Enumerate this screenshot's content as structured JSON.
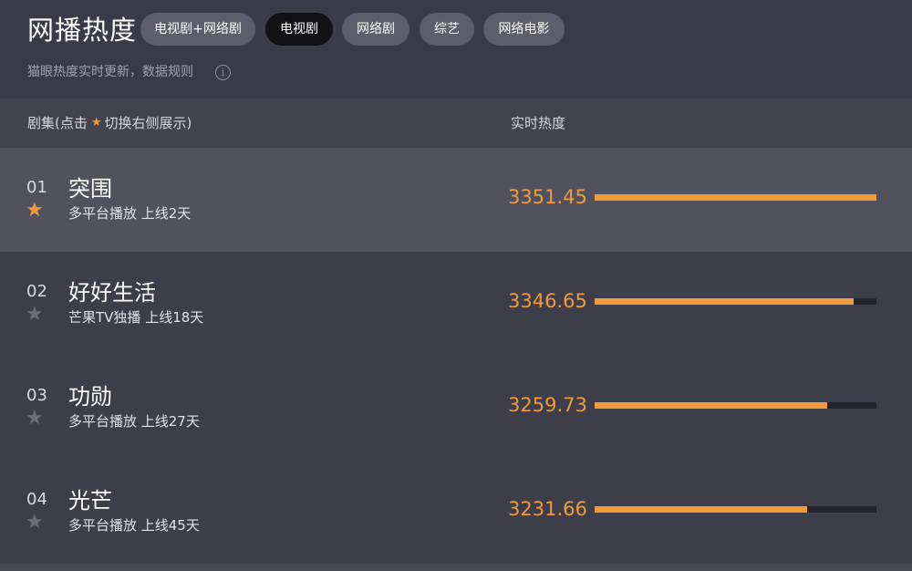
{
  "header": {
    "title": "网播热度",
    "tabs": [
      {
        "label": "电视剧+网络剧",
        "active": false
      },
      {
        "label": "电视剧",
        "active": true
      },
      {
        "label": "网络剧",
        "active": false
      },
      {
        "label": "综艺",
        "active": false
      },
      {
        "label": "网络电影",
        "active": false
      }
    ],
    "subtitle": "猫眼热度实时更新，数据规则",
    "info_icon": "info-icon"
  },
  "columns": {
    "left_prefix": "剧集(点击",
    "left_suffix": "切换右侧展示)",
    "right": "实时热度"
  },
  "rows": [
    {
      "rank": "01",
      "name": "突围",
      "meta": "多平台播放  上线2天",
      "score": "3351.45",
      "starred": true,
      "bar_fraction": 1.0
    },
    {
      "rank": "02",
      "name": "好好生活",
      "meta": "芒果TV独播  上线18天",
      "score": "3346.65",
      "starred": false,
      "bar_fraction": 0.92
    },
    {
      "rank": "03",
      "name": "功勋",
      "meta": "多平台播放  上线27天",
      "score": "3259.73",
      "starred": false,
      "bar_fraction": 0.825
    },
    {
      "rank": "04",
      "name": "光芒",
      "meta": "多平台播放  上线45天",
      "score": "3231.66",
      "starred": false,
      "bar_fraction": 0.755
    }
  ],
  "colors": {
    "accent": "#f09a3a",
    "background": "#3a3a48",
    "active_tab": "#111116",
    "tab": "#5d5d6c"
  }
}
